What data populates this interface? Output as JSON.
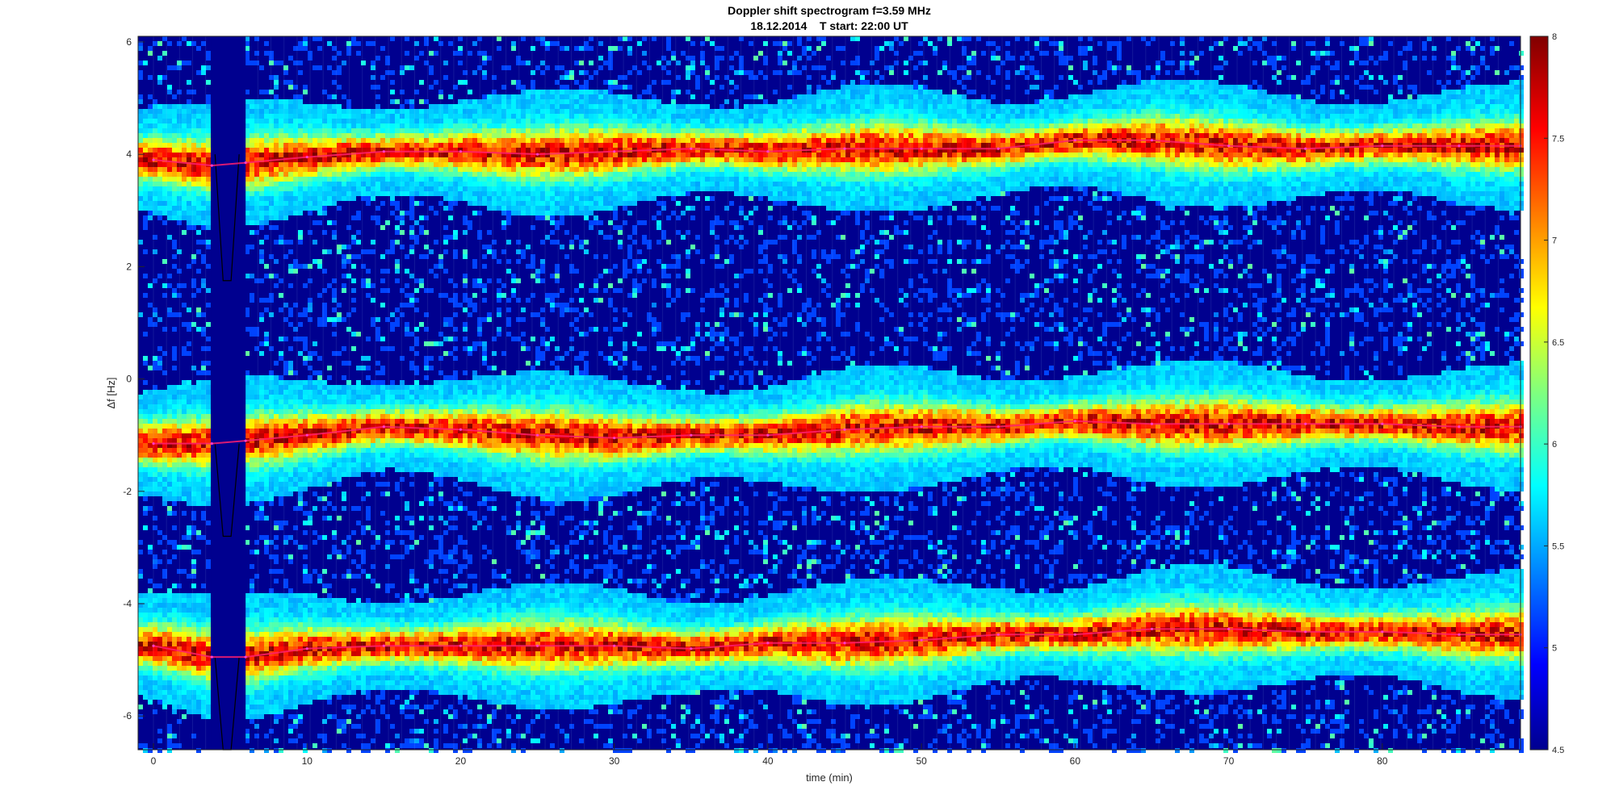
{
  "chart_data": {
    "type": "heatmap",
    "title": "Doppler shift spectrogram f=3.59 MHz",
    "subtitle": "18.12.2014    T start: 22:00 UT",
    "xlabel": "time (min)",
    "ylabel": "Δf [Hz]",
    "xlim": [
      -1,
      89
    ],
    "ylim": [
      -6.6,
      6.1
    ],
    "xticks": [
      0,
      10,
      20,
      30,
      40,
      50,
      60,
      70,
      80
    ],
    "yticks": [
      -6,
      -4,
      -2,
      0,
      2,
      4,
      6
    ],
    "colorbar": {
      "range": [
        4.5,
        8
      ],
      "ticks": [
        4.5,
        5,
        5.5,
        6,
        6.5,
        7,
        7.5,
        8
      ],
      "colormap": "jet"
    },
    "gap": {
      "x_start": 3.8,
      "x_end": 6.0
    },
    "series": [
      {
        "x": [
          0,
          3.8,
          6,
          10,
          15,
          20,
          25,
          30,
          35,
          40,
          45,
          50,
          55,
          60,
          65,
          70,
          75,
          80,
          85,
          89
        ],
        "y": [
          3.9,
          3.8,
          3.85,
          3.95,
          4.05,
          4.05,
          4.0,
          4.05,
          4.1,
          4.05,
          4.1,
          4.1,
          4.1,
          4.25,
          4.25,
          4.15,
          4.1,
          4.15,
          4.15,
          4.15
        ]
      },
      {
        "x": [
          0,
          3.8,
          6,
          10,
          15,
          20,
          25,
          30,
          35,
          40,
          45,
          50,
          55,
          60,
          65,
          70,
          75,
          80,
          85,
          89
        ],
        "y": [
          -1.15,
          -1.15,
          -1.1,
          -1.0,
          -0.85,
          -0.9,
          -1.0,
          -1.05,
          -1.0,
          -1.0,
          -0.9,
          -0.85,
          -0.85,
          -0.75,
          -0.8,
          -0.8,
          -0.8,
          -0.8,
          -0.85,
          -0.85
        ]
      },
      {
        "x": [
          0,
          3.8,
          6,
          10,
          15,
          20,
          25,
          30,
          35,
          40,
          45,
          50,
          55,
          60,
          65,
          70,
          75,
          80,
          85,
          89
        ],
        "y": [
          -4.75,
          -4.95,
          -4.95,
          -4.8,
          -4.75,
          -4.75,
          -4.75,
          -4.75,
          -4.8,
          -4.7,
          -4.7,
          -4.65,
          -4.55,
          -4.55,
          -4.45,
          -4.45,
          -4.5,
          -4.5,
          -4.55,
          -4.55
        ]
      }
    ]
  }
}
